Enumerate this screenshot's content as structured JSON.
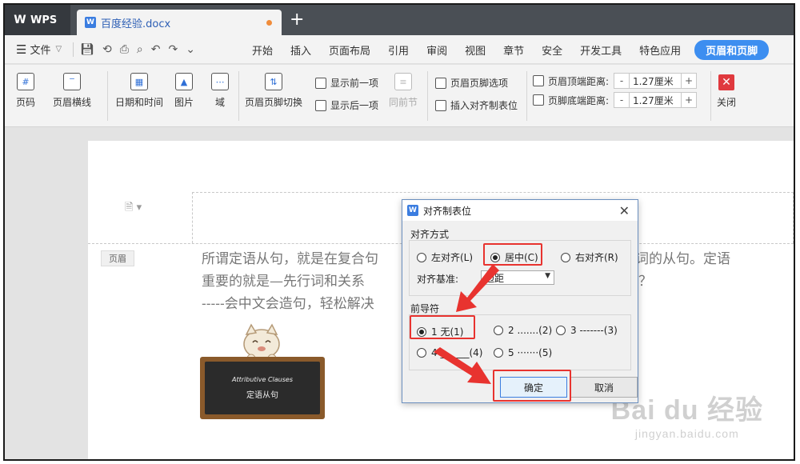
{
  "app": {
    "name": "WPS"
  },
  "document_tab": {
    "title": "百度经验.docx",
    "icon": "wps-doc-icon"
  },
  "menubar": {
    "file_label": "文件",
    "items": [
      "开始",
      "插入",
      "页面布局",
      "引用",
      "审阅",
      "视图",
      "章节",
      "安全",
      "开发工具",
      "特色应用",
      "页眉和页脚"
    ]
  },
  "ribbon": {
    "page_number": "页码",
    "header_line": "页眉横线",
    "date_time": "日期和时间",
    "picture": "图片",
    "field": "域",
    "switch_header_footer": "页眉页脚切换",
    "show_prev": "显示前一项",
    "show_next": "显示后一项",
    "same_as_prev": "同前节",
    "hf_options": "页眉页脚选项",
    "insert_aligned_tab": "插入对齐制表位",
    "header_top_distance_label": "页眉顶端距离:",
    "header_top_distance_value": "1.27厘米",
    "footer_bottom_distance_label": "页脚底端距离:",
    "footer_bottom_distance_value": "1.27厘米",
    "minus": "-",
    "plus": "+",
    "close": "关闭"
  },
  "document": {
    "header_label": "页眉",
    "lines": [
      "所谓定语从句，就是在复合句",
      "重要的就是—先行词和关系",
      "-----会中文会造句，轻松解决"
    ],
    "lines_right": [
      "词或代词的从句。定语",
      "词呢？"
    ],
    "image_title": "Attributive Clauses",
    "image_subtitle": "定语从句"
  },
  "dialog": {
    "title": "对齐制表位",
    "align_group": "对齐方式",
    "align_left": "左对齐(L)",
    "align_center": "居中(C)",
    "align_right": "右对齐(R)",
    "base_label": "对齐基准:",
    "base_value": "边距",
    "leader_group": "前导符",
    "leader_1": "1 无(1)",
    "leader_2": "2 .......(2)",
    "leader_3": "3 -------(3)",
    "leader_4": "4 ______(4)",
    "leader_5": "5 ·······(5)",
    "ok": "确定",
    "cancel": "取消",
    "selected_align": "居中(C)",
    "selected_leader": "1 无(1)"
  },
  "watermark": {
    "brand": "Bai du 经验",
    "url": "jingyan.baidu.com"
  },
  "colors": {
    "accent": "#3d8ef0",
    "highlight": "#e8332f",
    "tabbar": "#4a4f55"
  }
}
